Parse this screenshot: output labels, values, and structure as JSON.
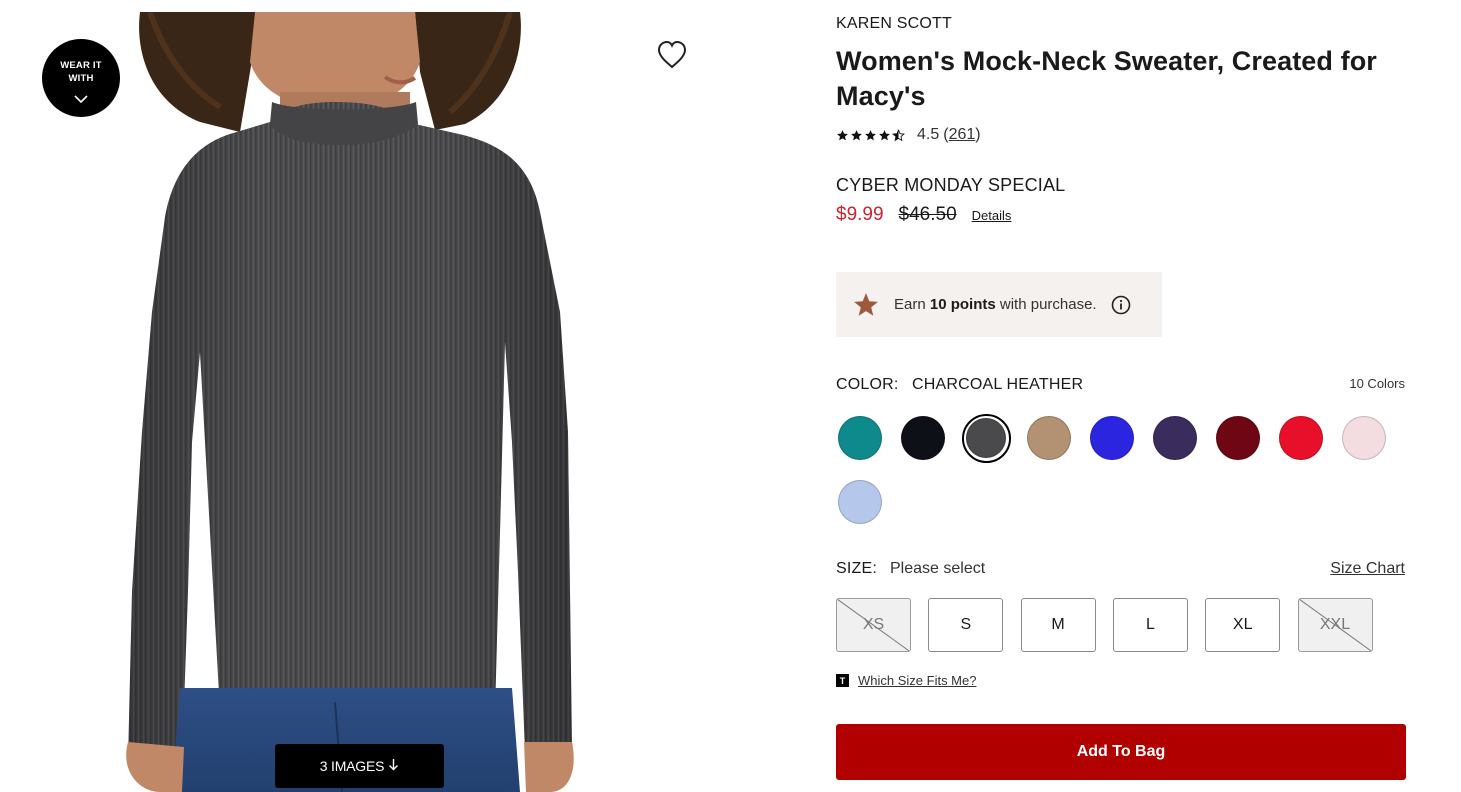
{
  "gallery": {
    "wear_it_with": "WEAR IT WITH",
    "images_button_label": "3 IMAGES",
    "icons": {
      "wear_it_with": "chevron-down-icon",
      "favorite": "heart-icon",
      "images": "arrow-down-icon"
    }
  },
  "product": {
    "brand": "KAREN SCOTT",
    "title": "Women's Mock-Neck Sweater, Created for Macy's",
    "rating": {
      "value": "4.5",
      "review_count": "261",
      "stars": 4.5,
      "max_stars": 5
    },
    "promo_label": "CYBER MONDAY SPECIAL",
    "sale_price": "$9.99",
    "original_price": "$46.50",
    "details_label": "Details"
  },
  "points": {
    "prefix": "Earn ",
    "points": "10 points",
    "suffix": " with purchase.",
    "icon": "star-icon",
    "info_icon": "info-icon",
    "star_color": "#a0583c"
  },
  "color": {
    "label": "COLOR:",
    "selected": "CHARCOAL HEATHER",
    "count_label": "10 Colors",
    "swatches": [
      {
        "color": "#0f8a8c"
      },
      {
        "color": "#0d1117"
      },
      {
        "color": "#4a4a4c",
        "selected": true
      },
      {
        "color": "#b39274"
      },
      {
        "color": "#2b25e0"
      },
      {
        "color": "#3a2c5c"
      },
      {
        "color": "#6e0713"
      },
      {
        "color": "#e80f2a"
      },
      {
        "color": "#f4dde0"
      },
      {
        "color": "#b5c8ec"
      }
    ]
  },
  "size": {
    "label": "SIZE:",
    "value": "Please select",
    "chart_label": "Size Chart",
    "options": [
      {
        "label": "XS",
        "available": false
      },
      {
        "label": "S",
        "available": true
      },
      {
        "label": "M",
        "available": true
      },
      {
        "label": "L",
        "available": true
      },
      {
        "label": "XL",
        "available": true
      },
      {
        "label": "XXL",
        "available": false
      }
    ],
    "which_size_badge": "T",
    "which_size_label": "Which Size Fits Me?"
  },
  "actions": {
    "add_to_bag": "Add To Bag",
    "add_to_bag_color": "#b00000"
  }
}
